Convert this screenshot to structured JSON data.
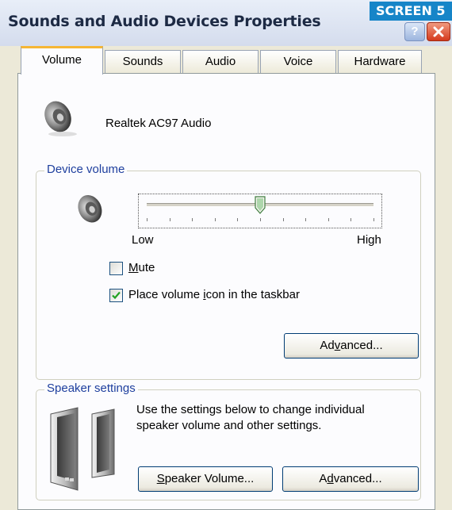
{
  "window": {
    "title": "Sounds and Audio Devices Properties",
    "badge": "SCREEN 5",
    "help": "?"
  },
  "tabs": [
    {
      "label": "Volume",
      "active": true
    },
    {
      "label": "Sounds",
      "active": false
    },
    {
      "label": "Audio",
      "active": false
    },
    {
      "label": "Voice",
      "active": false
    },
    {
      "label": "Hardware",
      "active": false
    }
  ],
  "device": {
    "name": "Realtek AC97 Audio",
    "icon": "speaker-icon"
  },
  "device_volume": {
    "group_label": "Device volume",
    "low_label": "Low",
    "high_label": "High",
    "level": 0.5,
    "mute": {
      "label_pre": "",
      "label_accel": "M",
      "label_post": "ute",
      "checked": false
    },
    "taskbar": {
      "label_pre": "Place volume ",
      "label_accel": "i",
      "label_post": "con in the taskbar",
      "checked": true
    },
    "advanced": {
      "label_pre": "Ad",
      "label_accel": "v",
      "label_post": "anced..."
    }
  },
  "speaker_settings": {
    "group_label": "Speaker settings",
    "description_line1": "Use the settings below to change individual",
    "description_line2": "speaker volume and other settings.",
    "speaker_volume": {
      "label_pre": "",
      "label_accel": "S",
      "label_post": "peaker Volume..."
    },
    "advanced": {
      "label_pre": "A",
      "label_accel": "d",
      "label_post": "vanced..."
    }
  }
}
